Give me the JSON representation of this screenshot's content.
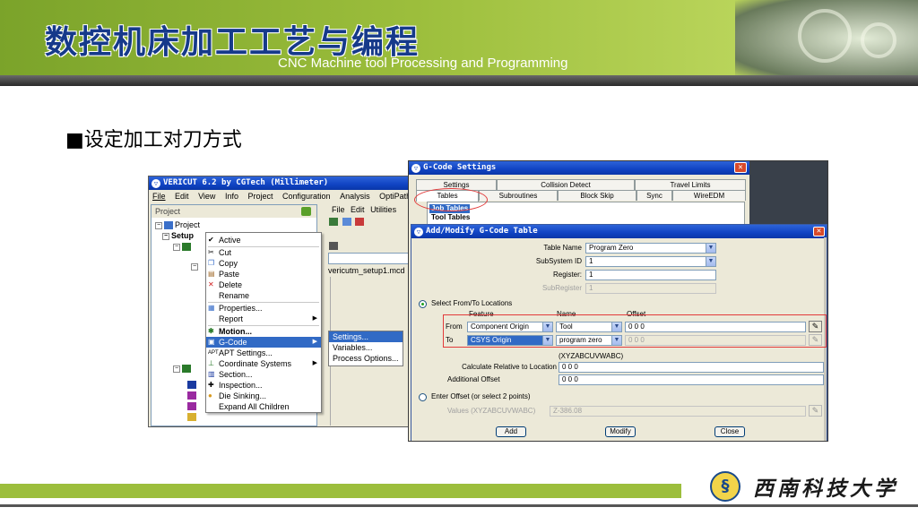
{
  "slide": {
    "banner_title": "数控机床加工工艺与编程",
    "banner_subtitle": "CNC Machine tool Processing and Programming",
    "heading": "■设定加工对刀方式",
    "footer_logo_glyph": "§",
    "footer_school": "西南科技大学",
    "colors": {
      "banner_green": "#9cbe3c",
      "title_blue": "#163a8a",
      "selection_blue": "#316ac5",
      "annotation_red": "#e23a3a"
    }
  },
  "vericut": {
    "title": "VERICUT 6.2 by CGTech (Millimeter)",
    "menubar": [
      "File",
      "Edit",
      "View",
      "Info",
      "Project",
      "Configuration",
      "Analysis",
      "OptiPath"
    ],
    "project_header": "Project",
    "tree": {
      "project": "Project",
      "setup": "Setup"
    },
    "context_menu": [
      "Active",
      "Cut",
      "Copy",
      "Paste",
      "Delete",
      "Rename",
      "Properties...",
      "Report",
      "Motion...",
      "G-Code",
      "APT Settings...",
      "Coordinate Systems",
      "Section...",
      "Inspection...",
      "Die Sinking...",
      "Expand All Children"
    ],
    "submenu": [
      "Settings...",
      "Variables...",
      "Process Options..."
    ],
    "right_menu": [
      "File",
      "Edit",
      "Utilities"
    ],
    "filename": "vericutm_setup1.mcd"
  },
  "gcode_settings": {
    "title": "G-Code Settings",
    "tabs_row1": [
      "Settings",
      "Collision Detect",
      "Travel Limits"
    ],
    "tabs_row2": [
      "Tables",
      "Subroutines",
      "Block Skip",
      "Sync",
      "WireEDM"
    ],
    "list": [
      "Job Tables",
      "Tool Tables"
    ]
  },
  "add_modify": {
    "title": "Add/Modify G-Code Table",
    "table_name_label": "Table Name",
    "table_name_value": "Program Zero",
    "subsystem_label": "SubSystem ID",
    "subsystem_value": "1",
    "register_label": "Register:",
    "register_value": "1",
    "subregister_label": "SubRegister",
    "subregister_value": "1",
    "select_fromto_label": "Select From/To Locations",
    "col_feature": "Feature",
    "col_name": "Name",
    "col_offset": "Offset",
    "from_label": "From",
    "from_feature": "Component Origin",
    "from_name": "Tool",
    "from_offset": "0 0 0",
    "to_label": "To",
    "to_feature": "CSYS Origin",
    "to_name": "program zero",
    "to_offset": "0 0 0",
    "offset_hint": "(XYZABCUVWABC)",
    "calc_label": "Calculate Relative to Location",
    "calc_value": "0 0 0",
    "additional_label": "Additional Offset",
    "additional_value": "0 0 0",
    "enter_offset_label": "Enter Offset (or select 2 points)",
    "values_label": "Values (XYZABCUVWABC)",
    "values_value": "Z-386.08",
    "add_button": "Add",
    "modify_button": "Modify",
    "close_button": "Close"
  }
}
